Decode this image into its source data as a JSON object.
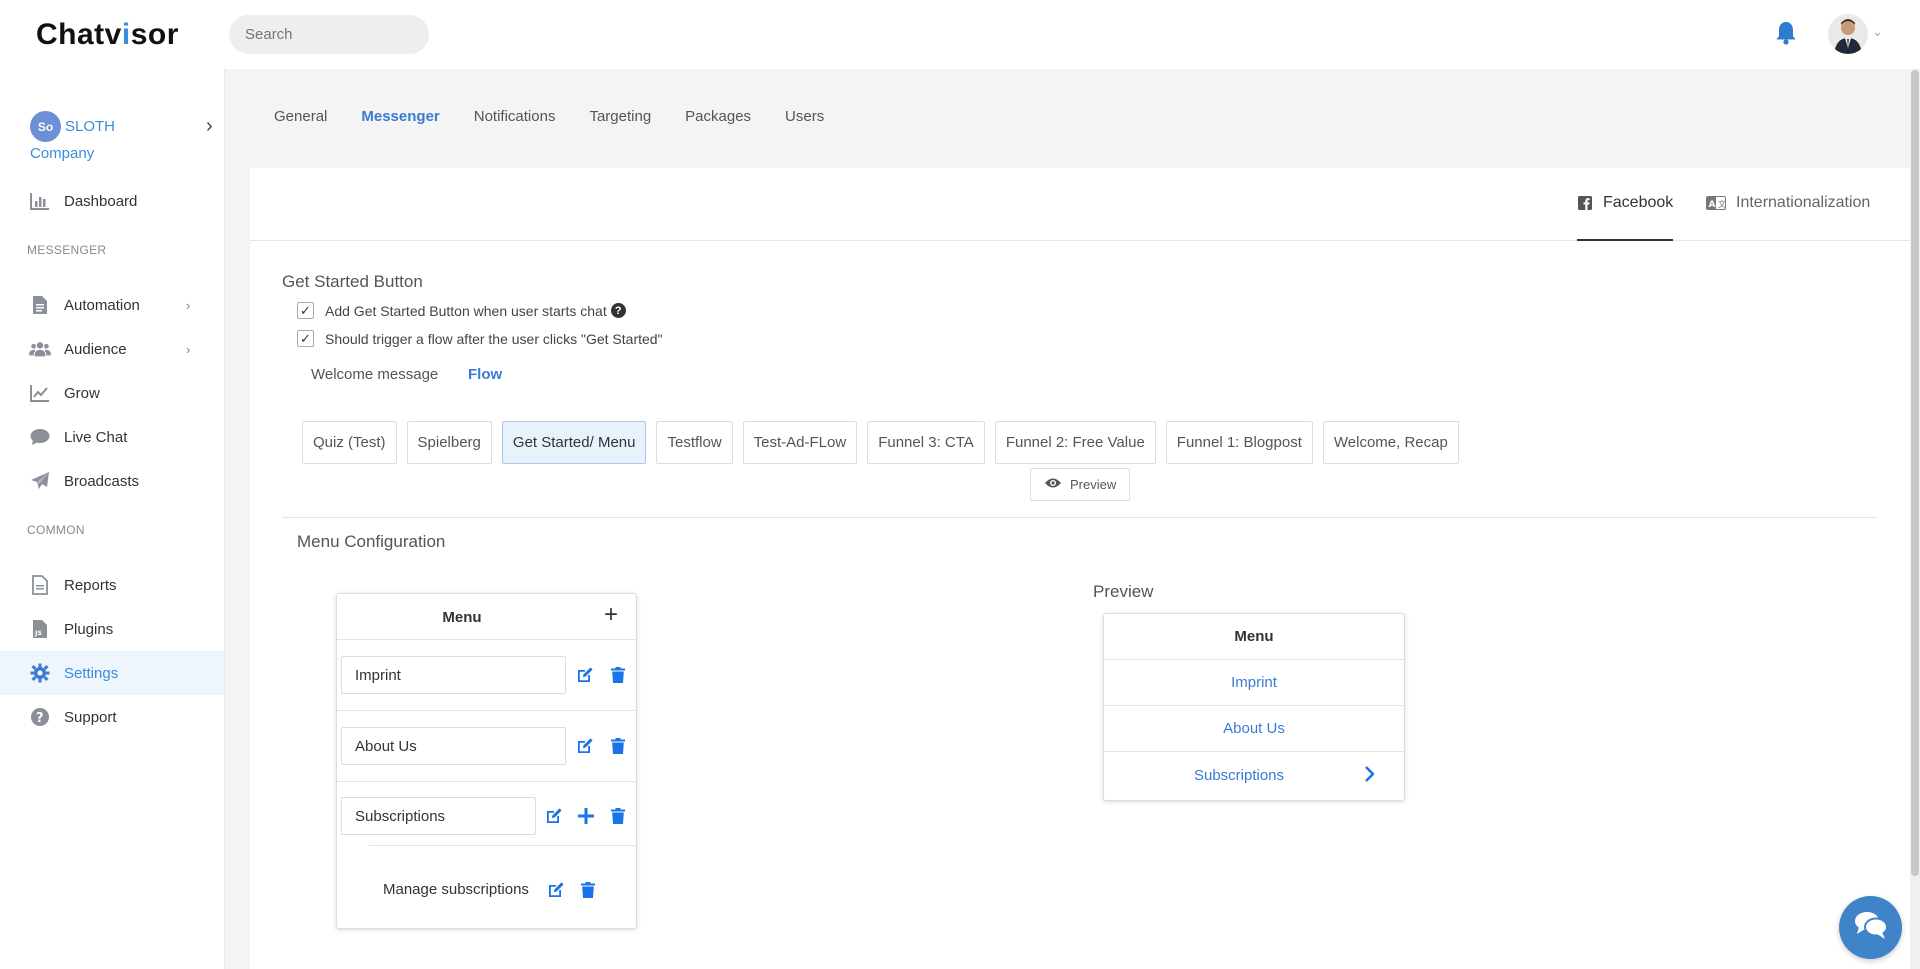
{
  "app": {
    "logo_text_prefix": "C",
    "logo_text": "hatv",
    "logo_text_dot": "i",
    "logo_text_suffix": "sor"
  },
  "header": {
    "search_placeholder": "Search"
  },
  "sidebar": {
    "company": {
      "logo_initials": "So",
      "name": "SLOTH",
      "subtitle": "Company"
    },
    "sections": {
      "messenger": "MESSENGER",
      "common": "COMMON"
    },
    "items": [
      {
        "label": "Dashboard",
        "icon": "bar-chart-icon"
      },
      {
        "label": "Automation",
        "icon": "document-icon"
      },
      {
        "label": "Audience",
        "icon": "users-icon"
      },
      {
        "label": "Grow",
        "icon": "line-chart-icon"
      },
      {
        "label": "Live Chat",
        "icon": "chat-bubble-icon"
      },
      {
        "label": "Broadcasts",
        "icon": "paper-plane-icon"
      },
      {
        "label": "Reports",
        "icon": "report-icon"
      },
      {
        "label": "Plugins",
        "icon": "js-file-icon"
      },
      {
        "label": "Settings",
        "icon": "gear-icon"
      },
      {
        "label": "Support",
        "icon": "question-circle-icon"
      }
    ]
  },
  "tabs": [
    "General",
    "Messenger",
    "Notifications",
    "Targeting",
    "Packages",
    "Users"
  ],
  "subtabs": {
    "facebook": "Facebook",
    "internationalization": "Internationalization"
  },
  "get_started": {
    "title": "Get Started Button",
    "check1": "Add Get Started Button when user starts chat",
    "check2": "Should trigger a flow after the user clicks \"Get Started\"",
    "mode_welcome": "Welcome message",
    "mode_flow": "Flow",
    "flows": [
      "Quiz (Test)",
      "Spielberg",
      "Get Started/ Menu",
      "Testflow",
      "Test-Ad-FLow",
      "Funnel 3: CTA",
      "Funnel 2: Free Value",
      "Funnel 1: Blogpost",
      "Welcome, Recap"
    ],
    "preview_button": "Preview"
  },
  "menu_config": {
    "title": "Menu Configuration",
    "editor_title": "Menu",
    "items": [
      "Imprint",
      "About Us",
      "Subscriptions"
    ],
    "sub_item": "Manage subscriptions"
  },
  "preview": {
    "title": "Preview",
    "menu_title": "Menu",
    "items": [
      "Imprint",
      "About Us",
      "Subscriptions"
    ]
  },
  "colors": {
    "accent": "#3a7bd5",
    "danger_blue": "#1a73e8"
  }
}
